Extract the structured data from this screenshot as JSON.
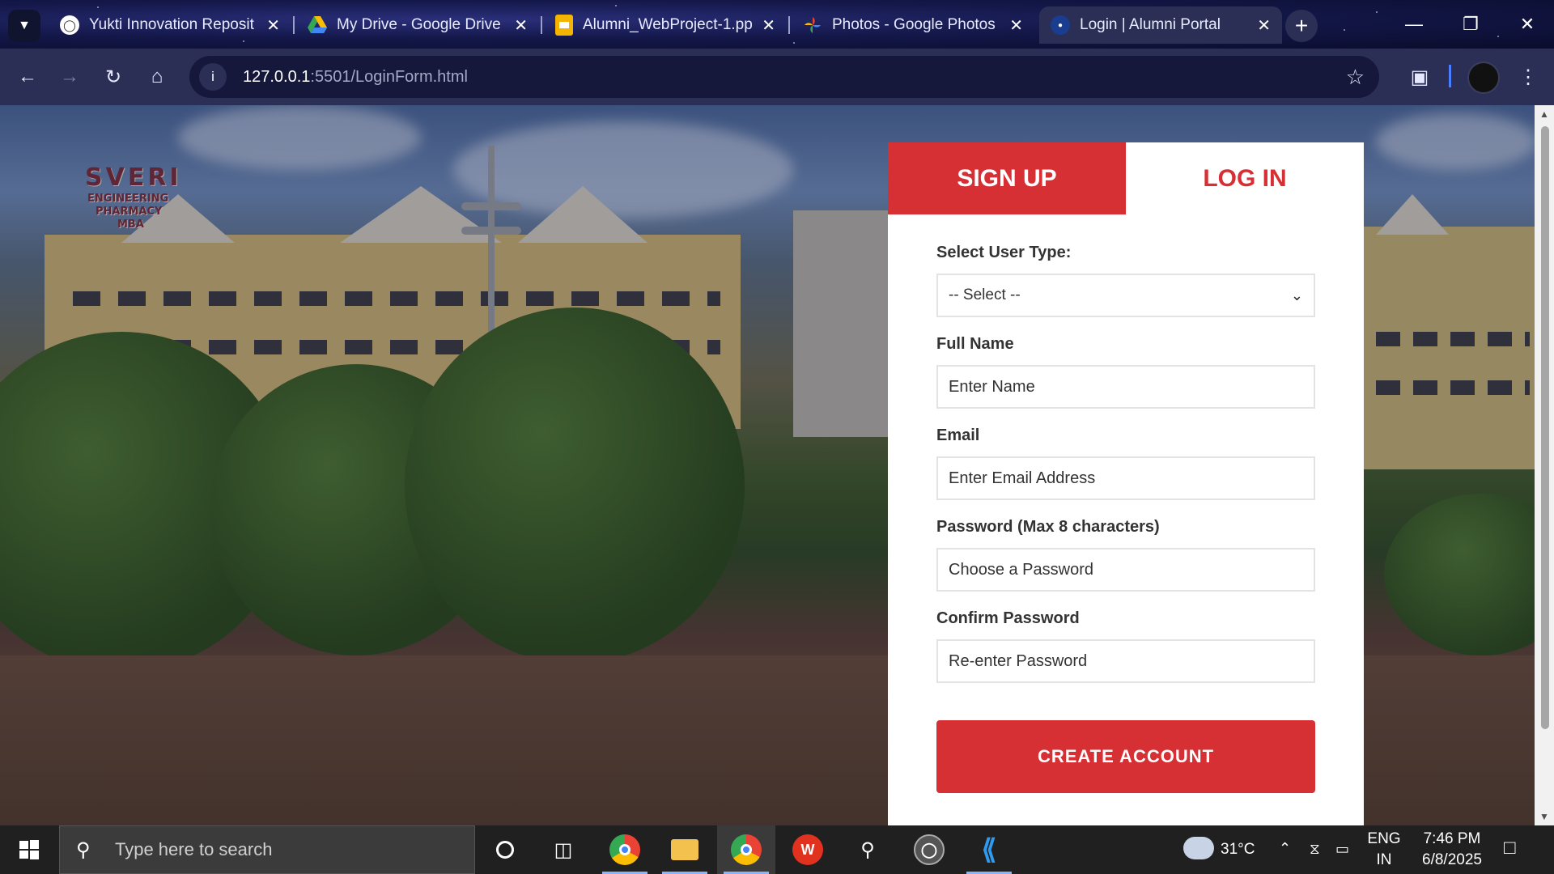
{
  "browser": {
    "tabs": [
      {
        "title": "Yukti Innovation Reposit",
        "active": false,
        "icon": "spiral-icon"
      },
      {
        "title": "My Drive - Google Drive",
        "active": false,
        "icon": "google-drive-icon"
      },
      {
        "title": "Alumni_WebProject-1.pp",
        "active": false,
        "icon": "google-slides-icon"
      },
      {
        "title": "Photos - Google Photos",
        "active": false,
        "icon": "google-photos-icon"
      },
      {
        "title": "Login | Alumni Portal",
        "active": true,
        "icon": "portal-logo-icon"
      }
    ],
    "address_host": "127.0.0.1",
    "address_rest": ":5501/LoginForm.html"
  },
  "page": {
    "tabs": {
      "signup": "SIGN UP",
      "login": "LOG IN"
    },
    "form": {
      "user_type_label": "Select User Type:",
      "user_type_value": "-- Select --",
      "fullname_label": "Full Name",
      "fullname_placeholder": "Enter Name",
      "email_label": "Email",
      "email_placeholder": "Enter Email Address",
      "password_label": "Password (Max 8 characters)",
      "password_placeholder": "Choose a Password",
      "confirm_label": "Confirm Password",
      "confirm_placeholder": "Re-enter Password",
      "submit_label": "CREATE ACCOUNT"
    },
    "background_sign": {
      "line1": "SVERI",
      "line2": "ENGINEERING",
      "line3": "PHARMACY",
      "line4": "MBA"
    }
  },
  "taskbar": {
    "search_placeholder": "Type here to search",
    "weather": "31°C",
    "lang_line1": "ENG",
    "lang_line2": "IN",
    "time": "7:46 PM",
    "date": "6/8/2025"
  },
  "colors": {
    "accent_red": "#d62f34",
    "tab_bg": "#2b2f55"
  }
}
